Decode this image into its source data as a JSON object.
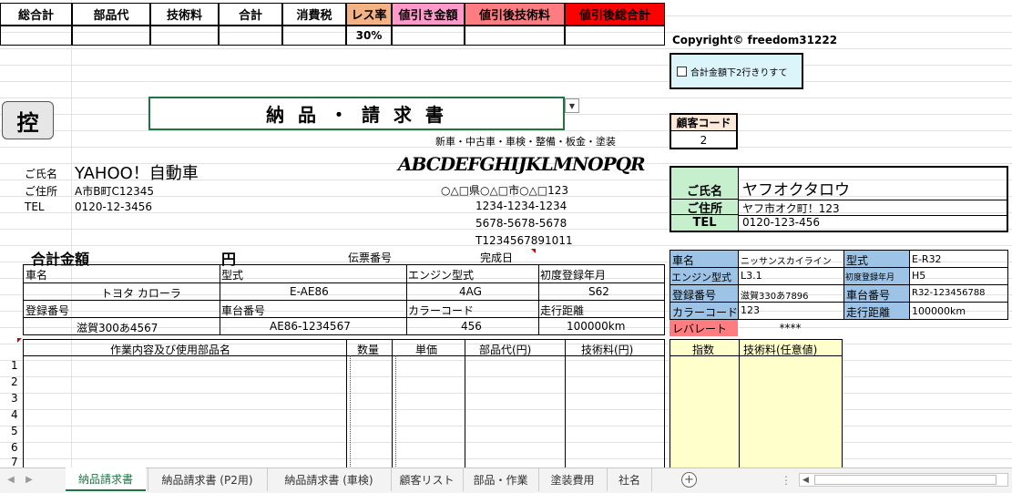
{
  "header": {
    "cells": [
      "総合計",
      "部品代",
      "技術料",
      "合計",
      "消費税",
      "レス率",
      "値引き金額",
      "値引後技術料",
      "値引後総合計"
    ],
    "less_rate": "30%",
    "colors": {
      "less": "#f4b183",
      "discount": "#ff99cc",
      "after_tech": "#ff7c80",
      "after_total": "#ff0000"
    }
  },
  "copyright": "Copyright© freedom31222",
  "checkbox_label": "合計金額下2行きりすて",
  "hikae": "控",
  "doc_title": "納 品 ・ 請 求 書",
  "subtitle": "新車・中古車・車検・整備・板金・塗装",
  "company_name": "ABCDEFGHIJKLMNOPQR",
  "company_address": "○△□県○△□市○△□123",
  "company_tel": "1234-1234-1234",
  "company_fax": "5678-5678-5678",
  "company_reg": "T1234567891011",
  "customer_left": {
    "name_label": "ご氏名",
    "name": "YAHOO！自動車",
    "addr_label": "ご住所",
    "addr": "A市B町C12345",
    "tel_label": "TEL",
    "tel": "0120-12-3456"
  },
  "customer_code": {
    "label": "顧客コード",
    "value": "2"
  },
  "customer_right": {
    "name_label": "ご氏名",
    "name": "ヤフオクタロウ",
    "addr_label": "ご住所",
    "addr": "ヤフ市オク町！123",
    "tel_label": "TEL",
    "tel": "0120-123-456"
  },
  "summary": {
    "total_label": "合計金額",
    "yen": "円",
    "slip_label": "伝票番号",
    "done_label": "完成日"
  },
  "vehicle": {
    "car_label": "車名",
    "model_label": "型式",
    "engine_label": "エンジン型式",
    "first_reg_label": "初度登録年月",
    "car": "トヨタ カローラ",
    "model": "E-AE86",
    "engine": "4AG",
    "first_reg": "S62",
    "reg_label": "登録番号",
    "chassis_label": "車台番号",
    "color_label": "カラーコード",
    "mileage_label": "走行距離",
    "reg": "滋賀300あ4567",
    "chassis": "AE86-1234567",
    "color": "456",
    "mileage": "100000km"
  },
  "vehicle_right": {
    "car_label": "車名",
    "car": "ニッサンスカイライン",
    "model_label": "型式",
    "model": "E-R32",
    "engine_label": "エンジン型式",
    "engine": "L3.1",
    "first_reg_label": "初度登録年月",
    "first_reg": "H5",
    "reg_label": "登録番号",
    "reg": "滋賀330あ7896",
    "chassis_label": "車台番号",
    "chassis": "R32-123456788",
    "color_label": "カラーコード",
    "color": "123",
    "mileage_label": "走行距離",
    "mileage": "100000km",
    "level_label": "レバレート",
    "level": "****"
  },
  "work_table": {
    "headers": [
      "作業内容及び使用部品名",
      "数量",
      "単価",
      "部品代(円)",
      "技術料(円)"
    ],
    "rows": [
      "1",
      "2",
      "3",
      "4",
      "5",
      "6",
      "7"
    ]
  },
  "index_table": {
    "headers": [
      "指数",
      "技術料(任意値)"
    ]
  },
  "tabs": [
    "納品請求書",
    "納品請求書 (P2用)",
    "納品請求書 (車検)",
    "顧客リスト",
    "部品・作業",
    "塗装費用",
    "社名"
  ],
  "active_tab": "納品請求書"
}
